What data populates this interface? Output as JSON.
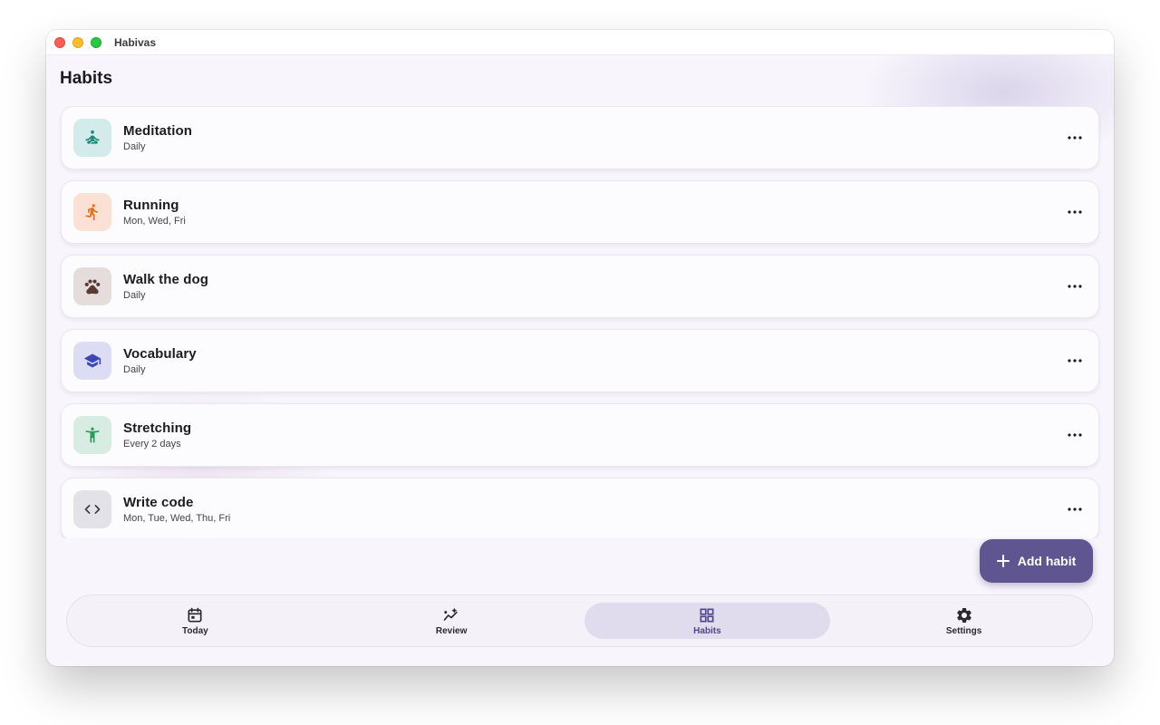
{
  "window": {
    "title": "Habivas"
  },
  "page": {
    "title": "Habits"
  },
  "habits": [
    {
      "name": "Meditation",
      "schedule": "Daily",
      "icon": "meditation-icon",
      "icon_color": "#1b8a7a",
      "icon_bg": "#d3ebea"
    },
    {
      "name": "Running",
      "schedule": "Mon, Wed, Fri",
      "icon": "running-icon",
      "icon_color": "#e8701a",
      "icon_bg": "#fbe1d3"
    },
    {
      "name": "Walk the dog",
      "schedule": "Daily",
      "icon": "paw-icon",
      "icon_color": "#5a3b33",
      "icon_bg": "#e5dcdc"
    },
    {
      "name": "Vocabulary",
      "schedule": "Daily",
      "icon": "graduation-cap-icon",
      "icon_color": "#3a47b5",
      "icon_bg": "#dcddf5"
    },
    {
      "name": "Stretching",
      "schedule": "Every 2 days",
      "icon": "stretching-icon",
      "icon_color": "#2e9a58",
      "icon_bg": "#d7ede3"
    },
    {
      "name": "Write code",
      "schedule": "Mon, Tue, Wed, Thu, Fri",
      "icon": "code-icon",
      "icon_color": "#3a3a44",
      "icon_bg": "#e2e2e8"
    }
  ],
  "fab": {
    "label": "Add habit",
    "icon": "plus-icon",
    "color": "#5f5590"
  },
  "nav": {
    "items": [
      {
        "label": "Today",
        "icon": "calendar-icon"
      },
      {
        "label": "Review",
        "icon": "insights-icon"
      },
      {
        "label": "Habits",
        "icon": "grid-icon",
        "active": true
      },
      {
        "label": "Settings",
        "icon": "gear-icon"
      }
    ]
  }
}
